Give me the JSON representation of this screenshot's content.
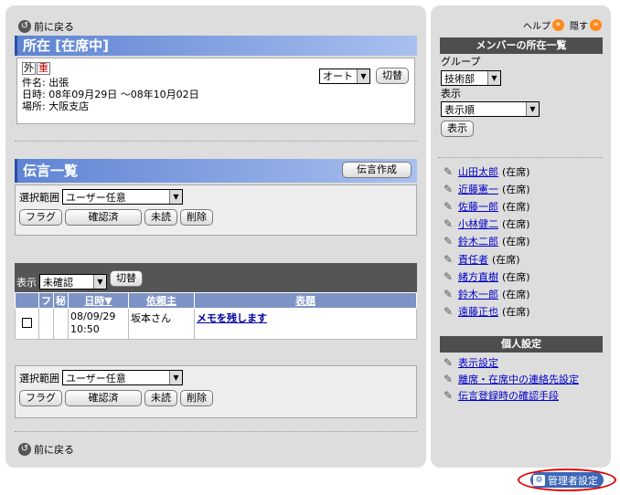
{
  "nav": {
    "back_label": "前に戻る"
  },
  "status": {
    "header": "所在 [在席中]",
    "tags": [
      "外",
      "重"
    ],
    "subject": "件名: 出張",
    "datetime": "日時: 08年09月29日 ～08年10月02日",
    "place": "場所: 大阪支店",
    "mode_select": "オート",
    "switch_label": "切替"
  },
  "messages": {
    "header": "伝言一覧",
    "create_label": "伝言作成",
    "range_label": "選択範囲",
    "range_value": "ユーザー任意",
    "buttons": {
      "flag": "フラグ",
      "confirmed": "確認済",
      "unread": "未読",
      "delete": "削除"
    },
    "display_label": "表示",
    "display_value": "未確認",
    "switch_label": "切替",
    "columns": {
      "fu": "フ",
      "secret": "秘",
      "datetime": "日時▼",
      "requester": "依頼主",
      "title": "表題"
    },
    "rows": [
      {
        "date": "08/09/29",
        "time": "10:50",
        "requester": "坂本さん",
        "title": "メモを残します"
      }
    ]
  },
  "sidebar": {
    "help_label": "ヘルプ",
    "hide_label": "隠す",
    "members_title": "メンバーの所在一覧",
    "group_label": "グループ",
    "group_value": "技術部",
    "display_label": "表示",
    "display_value": "表示順",
    "show_button": "表示",
    "members": [
      {
        "name": "山田太郎",
        "status": "(在席)"
      },
      {
        "name": "近藤憲一",
        "status": "(在席)"
      },
      {
        "name": "佐藤一郎",
        "status": "(在席)"
      },
      {
        "name": "小林健二",
        "status": "(在席)"
      },
      {
        "name": "鈴木二郎",
        "status": "(在席)"
      },
      {
        "name": "責任者",
        "status": "(在席)"
      },
      {
        "name": "緒方直樹",
        "status": "(在席)"
      },
      {
        "name": "鈴木一郎",
        "status": "(在席)"
      },
      {
        "name": "遠藤正也",
        "status": "(在席)"
      }
    ],
    "personal_title": "個人設定",
    "personal_links": [
      "表示設定",
      "離席・在席中の連絡先設定",
      "伝言登録時の確認手段"
    ]
  },
  "admin": {
    "label": "管理者設定"
  }
}
